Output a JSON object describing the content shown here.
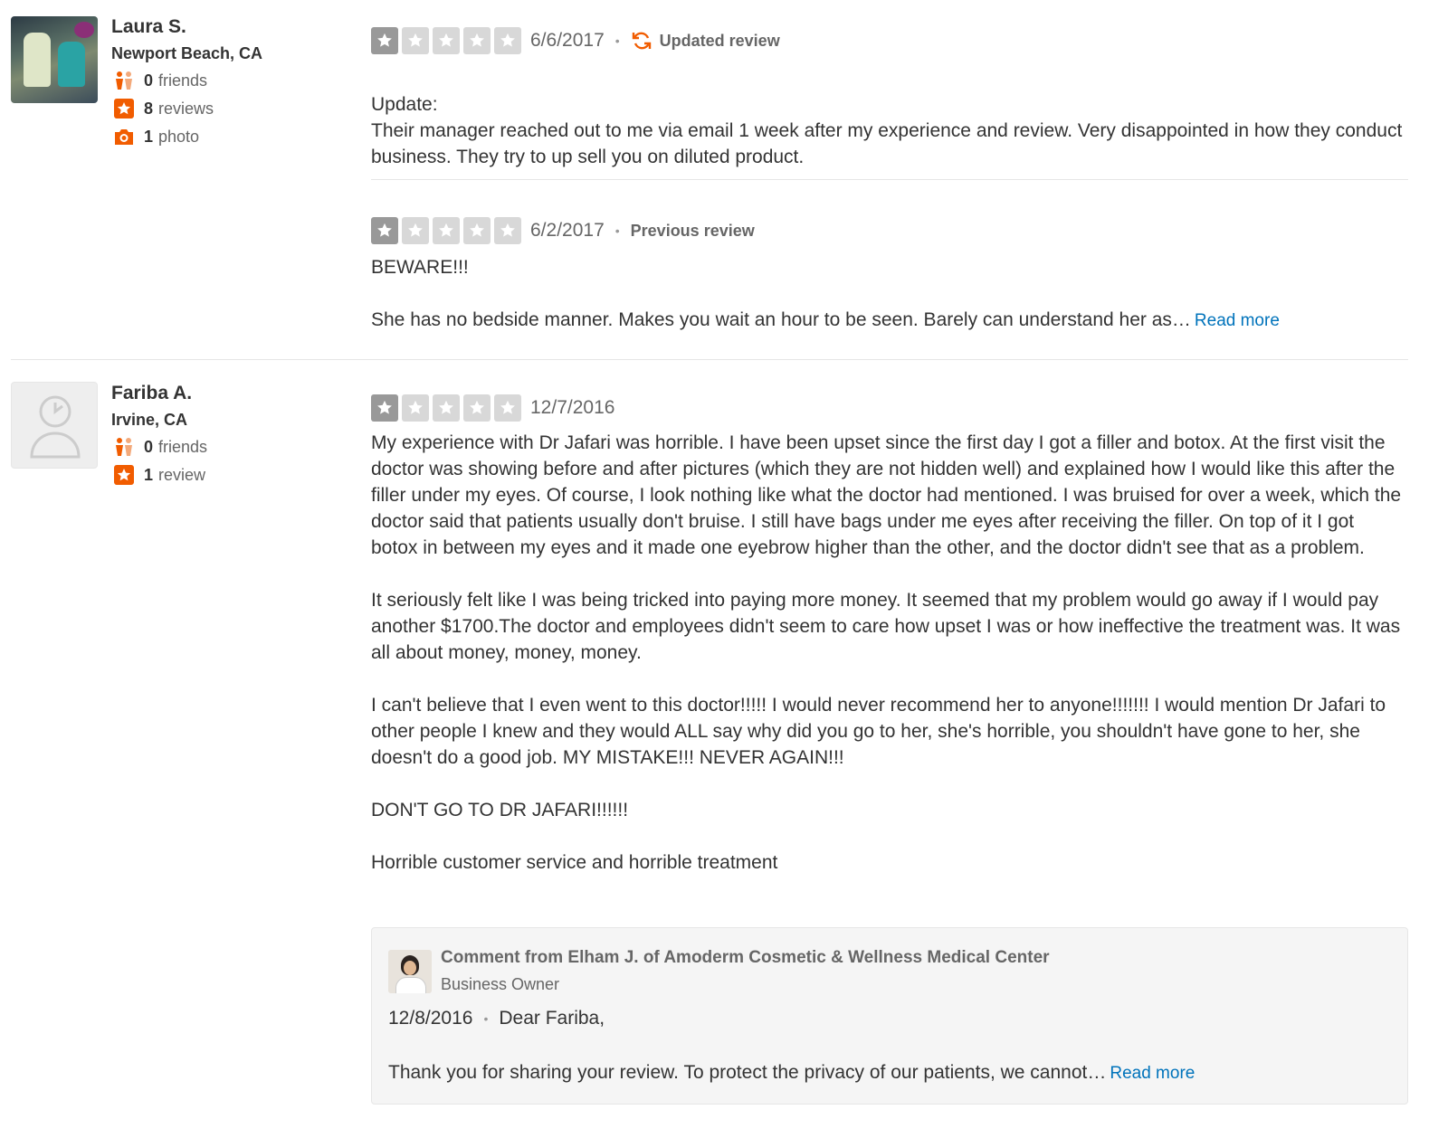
{
  "reviews": [
    {
      "user": {
        "name": "Laura S.",
        "location": "Newport Beach, CA",
        "friends_count": "0",
        "friends_label": "friends",
        "reviews_count": "8",
        "reviews_label": "reviews",
        "photos_count": "1",
        "photos_label": "photo",
        "avatar_icon": "user-photo"
      },
      "current": {
        "rating": 1,
        "date": "6/6/2017",
        "tag": "Updated review",
        "tag_icon": "refresh-icon",
        "paragraphs": [
          "Update:\nTheir manager reached out to me via email 1 week after my experience and review. Very disappointed in how they conduct business.   They try to up sell you on  diluted product."
        ]
      },
      "previous": {
        "rating": 1,
        "date": "6/2/2017",
        "tag": "Previous review",
        "paragraphs": [
          "BEWARE!!!"
        ],
        "excerpt": "She has no bedside manner. Makes you wait an hour to be seen.  Barely can understand her as…",
        "read_more": "Read more"
      }
    },
    {
      "user": {
        "name": "Fariba A.",
        "location": "Irvine, CA",
        "friends_count": "0",
        "friends_label": "friends",
        "reviews_count": "1",
        "reviews_label": "review",
        "avatar_icon": "default-user-icon"
      },
      "current": {
        "rating": 1,
        "date": "12/7/2016",
        "paragraphs": [
          "My experience with Dr Jafari was horrible. I have been upset since the first day I got a filler and botox. At the first visit the doctor was showing before and after pictures (which they are not hidden well) and explained how I would like this after the filler under my eyes. Of course, I look nothing like what the doctor had mentioned. I was bruised for over a week, which the doctor said that patients usually don't bruise. I still have bags under me eyes after receiving the filler. On top of it I got botox in between my eyes and it made one eyebrow higher than the other, and the doctor didn't see that as a problem.",
          "It seriously felt like I was being tricked into paying more money. It seemed that my problem would go away if I would pay another $1700.The doctor and employees didn't seem to care how upset I was or how ineffective the treatment was. It was all about money, money, money.",
          "I can't believe that I even went to this doctor!!!!! I would never recommend her to anyone!!!!!!! I would mention Dr Jafari to other people I knew and they would ALL say why did you go to her, she's horrible, you shouldn't have gone to her, she doesn't do a good job. MY MISTAKE!!! NEVER AGAIN!!!",
          "DON'T GO TO DR JAFARI!!!!!!",
          "Horrible customer service and horrible treatment"
        ]
      },
      "owner_comment": {
        "title": "Comment from Elham J. of Amoderm Cosmetic & Wellness Medical Center",
        "role": "Business Owner",
        "date": "12/8/2016",
        "greeting": "Dear Fariba,",
        "excerpt": "Thank you for sharing your review. To protect the privacy of our patients, we cannot…",
        "read_more": "Read more"
      }
    }
  ],
  "colors": {
    "star_filled": "#999999",
    "star_empty": "#d8d8d8",
    "link": "#0073bb",
    "brand_icon": "#f15c00"
  }
}
